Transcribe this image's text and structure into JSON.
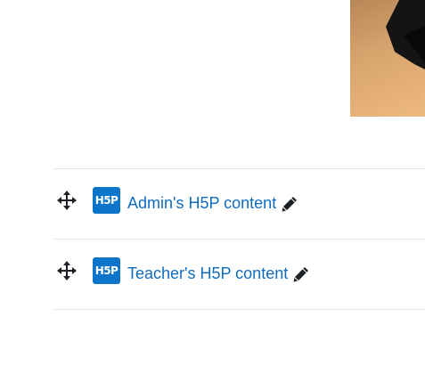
{
  "activities": [
    {
      "name": "Admin's H5P content",
      "icon": "h5p-icon",
      "icon_text": "H5P",
      "icon_color": "#0c75c9",
      "edit_icon": "pencil-icon",
      "move_icon": "move-icon"
    },
    {
      "name": "Teacher's H5P content",
      "icon": "h5p-icon",
      "icon_text": "H5P",
      "icon_color": "#0c75c9",
      "edit_icon": "pencil-icon",
      "move_icon": "move-icon"
    }
  ],
  "colors": {
    "link": "#0f6cbf",
    "divider": "#dee2e6",
    "icon_text": "#ffffff"
  }
}
